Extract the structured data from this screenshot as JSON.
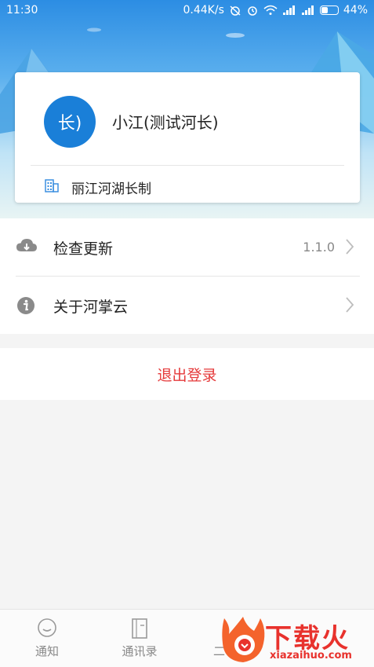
{
  "status_bar": {
    "time": "11:30",
    "network_speed": "0.44K/s",
    "battery_percent": "44%",
    "icons": [
      "alarm-off-icon",
      "alarm-icon",
      "wifi-icon",
      "signal-icon",
      "signal-icon",
      "battery-icon"
    ]
  },
  "profile": {
    "avatar_text": "长)",
    "name": "小江(测试河长)",
    "organization": "丽江河湖长制",
    "organization_icon": "building-icon"
  },
  "menu": {
    "items": [
      {
        "label": "检查更新",
        "value": "1.1.0",
        "icon": "cloud-download-icon"
      },
      {
        "label": "关于河掌云",
        "value": "",
        "icon": "info-icon"
      }
    ]
  },
  "logout_label": "退出登录",
  "tabbar": {
    "tabs": [
      {
        "label": "通知",
        "icon": "chat-bubble-icon"
      },
      {
        "label": "通讯录",
        "icon": "contacts-book-icon"
      },
      {
        "label": "二",
        "icon": ""
      }
    ]
  },
  "watermark": {
    "title": "下载火",
    "subtitle": "xiazaihuo.com"
  },
  "colors": {
    "header_blue": "#2c8de3",
    "avatar_blue": "#1a7fd8",
    "logout_red": "#e5393a",
    "watermark_red": "#e8322d"
  }
}
